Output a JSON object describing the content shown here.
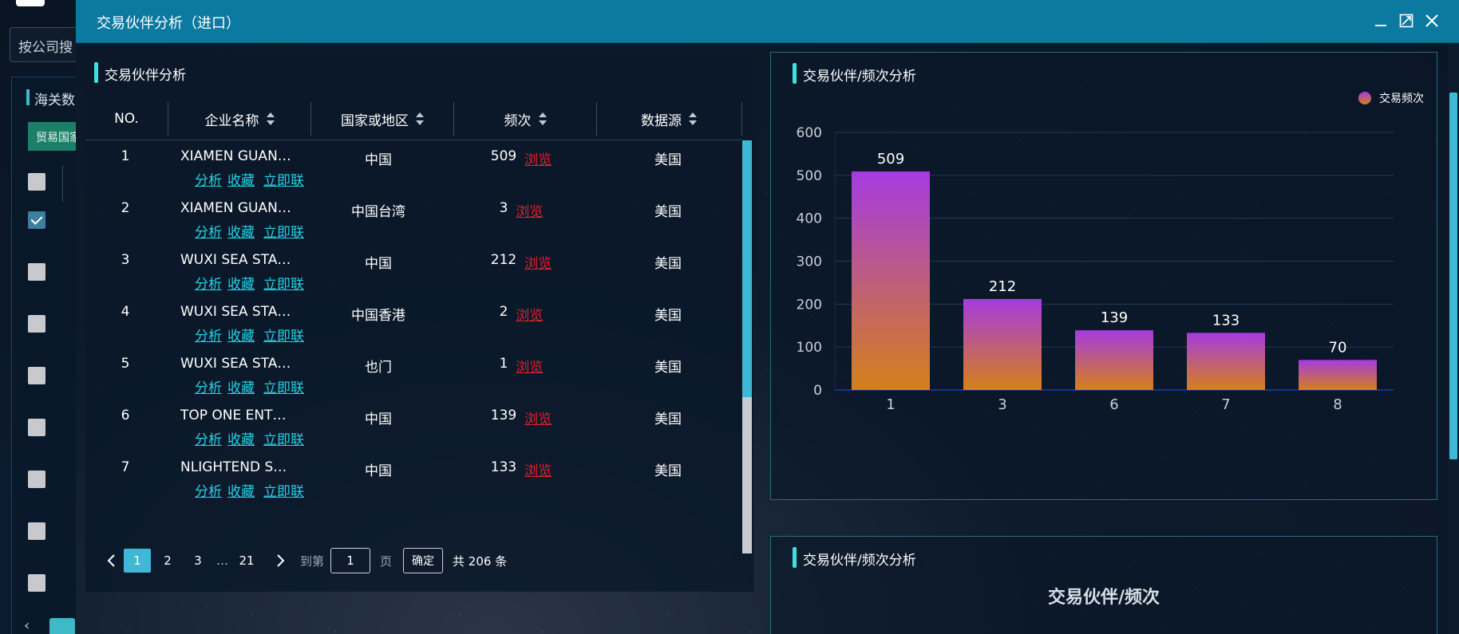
{
  "background": {
    "search_placeholder": "按公司搜",
    "panel_title": "海关数",
    "trade_button": "贸易国家"
  },
  "modal": {
    "title": "交易伙伴分析（进口）",
    "icons": [
      "minimize-icon",
      "maximize-icon",
      "close-icon"
    ]
  },
  "left_panel": {
    "title": "交易伙伴分析",
    "columns": {
      "no": "NO.",
      "company": "企业名称",
      "country": "国家或地区",
      "frequency": "频次",
      "source": "数据源"
    },
    "action_labels": {
      "analyze": "分析",
      "favorite": "收藏",
      "contact": "立即联"
    },
    "browse_label": "浏览",
    "rows": [
      {
        "no": "1",
        "company": "XIAMEN GUAN…",
        "country": "中国",
        "freq": "509",
        "source": "美国"
      },
      {
        "no": "2",
        "company": "XIAMEN GUAN…",
        "country": "中国台湾",
        "freq": "3",
        "source": "美国"
      },
      {
        "no": "3",
        "company": "WUXI SEA STA…",
        "country": "中国",
        "freq": "212",
        "source": "美国"
      },
      {
        "no": "4",
        "company": "WUXI SEA STA…",
        "country": "中国香港",
        "freq": "2",
        "source": "美国"
      },
      {
        "no": "5",
        "company": "WUXI SEA STA…",
        "country": "也门",
        "freq": "1",
        "source": "美国"
      },
      {
        "no": "6",
        "company": "TOP ONE ENT…",
        "country": "中国",
        "freq": "139",
        "source": "美国"
      },
      {
        "no": "7",
        "company": "NLIGHTEND S…",
        "country": "中国",
        "freq": "133",
        "source": "美国"
      }
    ],
    "pagination": {
      "pages": [
        "1",
        "2",
        "3"
      ],
      "ellipsis": "…",
      "last_page": "21",
      "goto_label": "到第",
      "goto_value": "1",
      "page_label": "页",
      "confirm_label": "确定",
      "total_text": "共 206 条"
    }
  },
  "chart_panel": {
    "title": "交易伙伴/频次分析",
    "legend": "交易频次"
  },
  "chart_data": {
    "type": "bar",
    "categories": [
      "1",
      "3",
      "6",
      "7",
      "8"
    ],
    "values": [
      509,
      212,
      139,
      133,
      70
    ],
    "series": [
      {
        "name": "交易频次",
        "values": [
          509,
          212,
          139,
          133,
          70
        ]
      }
    ],
    "ylim": [
      0,
      600
    ],
    "yticks": [
      0,
      100,
      200,
      300,
      400,
      500,
      600
    ],
    "grid": true,
    "legend_position": "top-right",
    "bar_gradient": [
      "#a63be0",
      "#d5801a"
    ],
    "title": "",
    "xlabel": "",
    "ylabel": ""
  },
  "chart_panel2": {
    "title": "交易伙伴/频次分析",
    "chart_title": "交易伙伴/频次"
  },
  "colors": {
    "header": "#0c7aa0",
    "accent": "#3fb8d8",
    "link": "#24d2e6",
    "browse": "#e0212b"
  }
}
